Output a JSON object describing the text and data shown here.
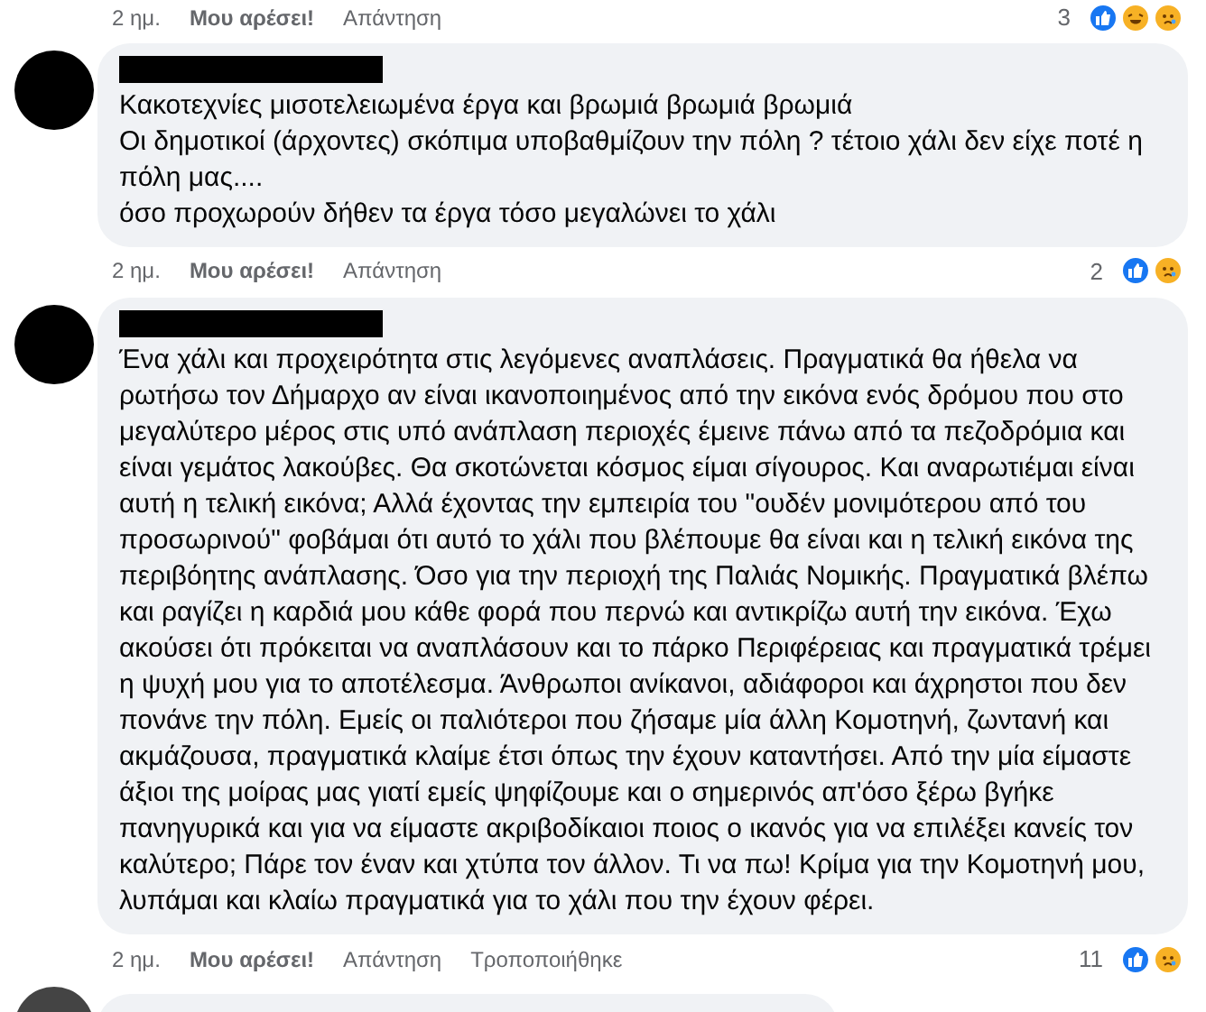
{
  "previous_actions": {
    "time": "2 ημ.",
    "like": "Μου αρέσει!",
    "reply": "Απάντηση",
    "count": "3",
    "reactions": [
      {
        "kind": "like"
      },
      {
        "kind": "haha"
      },
      {
        "kind": "sad"
      }
    ]
  },
  "comments": [
    {
      "lines": [
        "Κακοτεχνίες μισοτελειωμένα έργα και βρωμιά βρωμιά βρωμιά",
        "Οι δημοτικοί (άρχοντες) σκόπιμα υποβαθμίζουν την πόλη ? τέτοιο χάλι δεν είχε ποτέ η πόλη μας....",
        "όσο προχωρούν δήθεν τα έργα τόσο μεγαλώνει το χάλι"
      ],
      "time": "2 ημ.",
      "like": "Μου αρέσει!",
      "reply": "Απάντηση",
      "count": "2",
      "reactions": [
        {
          "kind": "like"
        },
        {
          "kind": "sad"
        }
      ]
    },
    {
      "lines": [
        "Ένα χάλι και προχειρότητα στις λεγόμενες αναπλάσεις. Πραγματικά θα ήθελα να ρωτήσω τον Δήμαρχο αν είναι ικανοποιημένος από την εικόνα ενός δρόμου που στο μεγαλύτερο μέρος στις υπό ανάπλαση περιοχές έμεινε πάνω από τα πεζοδρόμια και είναι γεμάτος λακούβες. Θα σκοτώνεται κόσμος είμαι σίγουρος. Και αναρωτιέμαι είναι αυτή η τελική εικόνα; Αλλά έχοντας την εμπειρία του \"ουδέν μονιμότερου από του προσωρινού\" φοβάμαι ότι αυτό το χάλι που βλέπουμε θα είναι και η τελική εικόνα της περιβόητης ανάπλασης. Όσο για την περιοχή της Παλιάς Νομικής. Πραγματικά βλέπω και ραγίζει η καρδιά μου κάθε φορά που περνώ και αντικρίζω αυτή την εικόνα. Έχω ακούσει ότι πρόκειται να αναπλάσουν και το πάρκο Περιφέρειας και πραγματικά τρέμει η ψυχή μου για το αποτέλεσμα. Άνθρωποι ανίκανοι, αδιάφοροι και άχρηστοι που δεν πονάνε την πόλη. Εμείς οι παλιότεροι που ζήσαμε μία άλλη Κομοτηνή, ζωντανή και ακμάζουσα, πραγματικά κλαίμε έτσι όπως την έχουν καταντήσει. Από την μία είμαστε άξιοι της μοίρας μας γιατί εμείς ψηφίζουμε και ο σημερινός απ'όσο ξέρω βγήκε πανηγυρικά και για να είμαστε ακριβοδίκαιοι ποιος ο ικανός για να επιλέξει κανείς τον καλύτερο; Πάρε τον έναν και χτύπα τον άλλον. Τι να πω! Κρίμα για την Κομοτηνή μου, λυπάμαι και κλαίω πραγματικά για το χάλι που την έχουν φέρει."
      ],
      "time": "2 ημ.",
      "like": "Μου αρέσει!",
      "reply": "Απάντηση",
      "edited": "Τροποποιήθηκε",
      "count": "11",
      "reactions": [
        {
          "kind": "like"
        },
        {
          "kind": "sad"
        }
      ]
    }
  ]
}
